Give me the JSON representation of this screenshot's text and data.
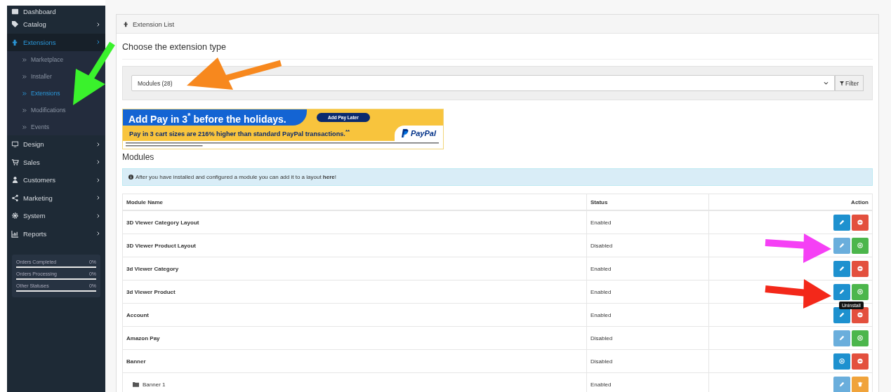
{
  "sidebar": {
    "items": [
      {
        "label": "Dashboard",
        "selected": false,
        "has_arrow": false
      },
      {
        "label": "Catalog",
        "selected": false,
        "has_arrow": true
      },
      {
        "label": "Extensions",
        "selected": true,
        "has_arrow": true,
        "children": [
          {
            "label": "Marketplace",
            "selected": false
          },
          {
            "label": "Installer",
            "selected": false
          },
          {
            "label": "Extensions",
            "selected": true
          },
          {
            "label": "Modifications",
            "selected": false
          },
          {
            "label": "Events",
            "selected": false
          }
        ]
      },
      {
        "label": "Design",
        "selected": false,
        "has_arrow": true
      },
      {
        "label": "Sales",
        "selected": false,
        "has_arrow": true
      },
      {
        "label": "Customers",
        "selected": false,
        "has_arrow": true
      },
      {
        "label": "Marketing",
        "selected": false,
        "has_arrow": true
      },
      {
        "label": "System",
        "selected": false,
        "has_arrow": true
      },
      {
        "label": "Reports",
        "selected": false,
        "has_arrow": true
      }
    ],
    "stats": [
      {
        "label": "Orders Completed",
        "value": "0%"
      },
      {
        "label": "Orders Processing",
        "value": "0%"
      },
      {
        "label": "Other Statuses",
        "value": "0%"
      }
    ]
  },
  "panel": {
    "title": "Extension List",
    "heading": "Choose the extension type",
    "type_select": {
      "value": "Modules (28)"
    },
    "filter_button": "Filter",
    "ad": {
      "headline": "Add Pay in 3$^{*}$ before the holidays.",
      "cta": "Add Pay Later",
      "subline": "Pay in 3 cart sizes are 216% higher than standard PayPal transactions.$^{**}$",
      "logo": "PayPal"
    },
    "section_title": "Modules",
    "alert": {
      "text": "After you have installed and configured a module you can add it to a layout ",
      "link": "here",
      "suffix": "!"
    },
    "table": {
      "columns": [
        "Module Name",
        "Status",
        "Action"
      ],
      "rows": [
        {
          "name": "3D Viewer Category Layout",
          "status": "Enabled",
          "actions": [
            {
              "kind": "edit"
            },
            {
              "kind": "uninstall"
            }
          ]
        },
        {
          "name": "3D Viewer Product Layout",
          "status": "Disabled",
          "actions": [
            {
              "kind": "edit-disabled"
            },
            {
              "kind": "install"
            }
          ]
        },
        {
          "name": "3d Viewer Category",
          "status": "Enabled",
          "actions": [
            {
              "kind": "edit"
            },
            {
              "kind": "uninstall"
            }
          ]
        },
        {
          "name": "3d Viewer Product",
          "status": "Enabled",
          "actions": [
            {
              "kind": "edit"
            },
            {
              "kind": "install",
              "tooltip": "Uninstall"
            }
          ]
        },
        {
          "name": "Account",
          "status": "Enabled",
          "actions": [
            {
              "kind": "edit"
            },
            {
              "kind": "uninstall"
            }
          ]
        },
        {
          "name": "Amazon Pay",
          "status": "Disabled",
          "actions": [
            {
              "kind": "edit-disabled"
            },
            {
              "kind": "install"
            }
          ]
        },
        {
          "name": "Banner",
          "status": "Disabled",
          "actions": [
            {
              "kind": "add"
            },
            {
              "kind": "uninstall"
            }
          ],
          "children": [
            {
              "name": "Banner 1",
              "status": "Enabled",
              "actions": [
                {
                  "kind": "edit-disabled"
                },
                {
                  "kind": "delete"
                }
              ]
            }
          ]
        }
      ]
    }
  }
}
